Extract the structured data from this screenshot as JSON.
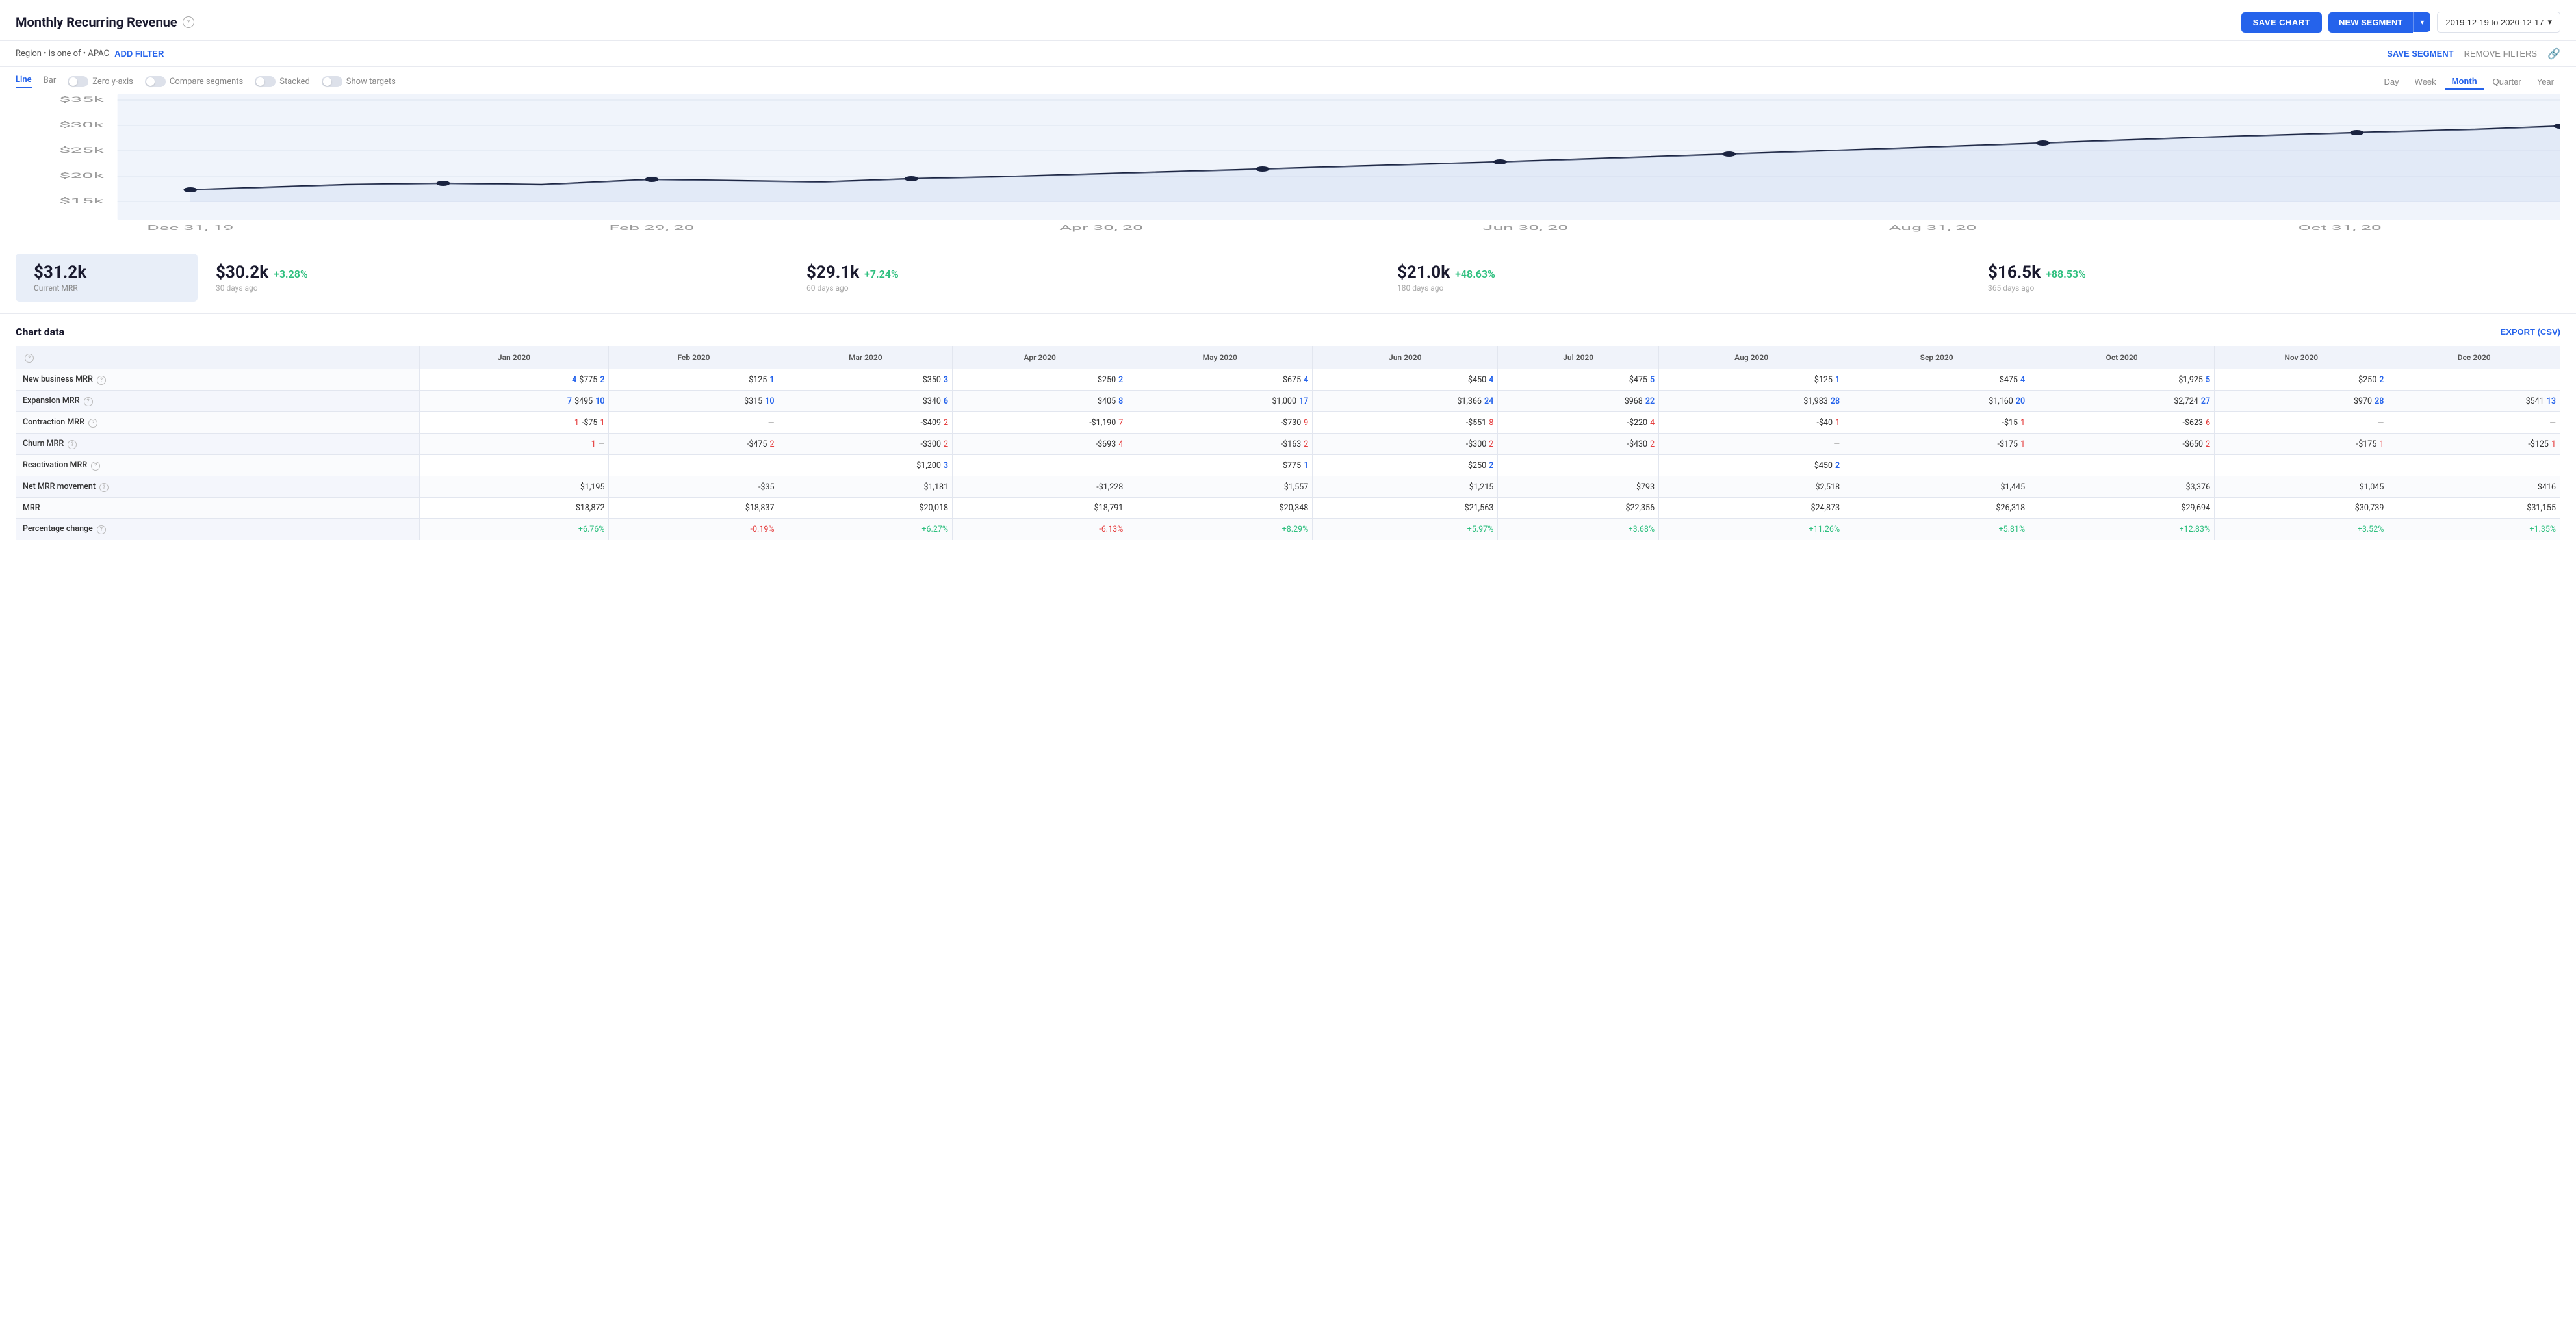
{
  "header": {
    "title": "Monthly Recurring Revenue",
    "save_chart_label": "SAVE CHART",
    "new_segment_label": "NEW SEGMENT",
    "date_range": "2019-12-19 to 2020-12-17"
  },
  "filter_bar": {
    "filter_text": "Region • is one of • APAC",
    "add_filter_label": "ADD FILTER",
    "save_segment_label": "SAVE SEGMENT",
    "remove_filters_label": "REMOVE FILTERS"
  },
  "chart_controls": {
    "tabs": [
      "Line",
      "Bar"
    ],
    "active_tab": "Line",
    "toggles": [
      {
        "label": "Zero y-axis",
        "enabled": false
      },
      {
        "label": "Compare segments",
        "enabled": false
      },
      {
        "label": "Stacked",
        "enabled": false
      },
      {
        "label": "Show targets",
        "enabled": false
      }
    ],
    "period_buttons": [
      "Day",
      "Week",
      "Month",
      "Quarter",
      "Year"
    ],
    "active_period": "Month"
  },
  "chart": {
    "y_labels": [
      "$35k",
      "$30k",
      "$25k",
      "$20k",
      "$15k"
    ],
    "x_labels": [
      "Dec 31, 19",
      "Feb 29, 20",
      "Apr 30, 20",
      "Jun 30, 20",
      "Aug 31, 20",
      "Oct 31, 20"
    ],
    "data_points": [
      {
        "x": 0.03,
        "y": 0.72
      },
      {
        "x": 0.1,
        "y": 0.64
      },
      {
        "x": 0.18,
        "y": 0.63
      },
      {
        "x": 0.27,
        "y": 0.64
      },
      {
        "x": 0.36,
        "y": 0.59
      },
      {
        "x": 0.43,
        "y": 0.61
      },
      {
        "x": 0.5,
        "y": 0.59
      },
      {
        "x": 0.52,
        "y": 0.57
      },
      {
        "x": 0.59,
        "y": 0.52
      },
      {
        "x": 0.66,
        "y": 0.49
      },
      {
        "x": 0.73,
        "y": 0.4
      },
      {
        "x": 0.82,
        "y": 0.33
      },
      {
        "x": 0.89,
        "y": 0.27
      },
      {
        "x": 0.93,
        "y": 0.22
      },
      {
        "x": 0.98,
        "y": 0.18
      },
      {
        "x": 1.0,
        "y": 0.16
      }
    ]
  },
  "stats": [
    {
      "value": "$31.2k",
      "label": "Current MRR",
      "change": null,
      "sub": null,
      "highlight": true
    },
    {
      "value": "$30.2k",
      "label": "30 days ago",
      "change": "+3.28%",
      "positive": true
    },
    {
      "value": "$29.1k",
      "label": "60 days ago",
      "change": "+7.24%",
      "positive": true
    },
    {
      "value": "$21.0k",
      "label": "180 days ago",
      "change": "+48.63%",
      "positive": true
    },
    {
      "value": "$16.5k",
      "label": "365 days ago",
      "change": "+88.53%",
      "positive": true
    }
  ],
  "chart_data": {
    "title": "Chart data",
    "export_label": "EXPORT (CSV)",
    "columns": [
      "",
      "Jan 2020",
      "Feb 2020",
      "Mar 2020",
      "Apr 2020",
      "May 2020",
      "Jun 2020",
      "Jul 2020",
      "Aug 2020",
      "Sep 2020",
      "Oct 2020",
      "Nov 2020",
      "Dec 2020"
    ],
    "rows": [
      {
        "label": "New business MRR",
        "has_help": true,
        "cells": [
          {
            "val": "$775",
            "count": "4",
            "count_color": "blue"
          },
          {
            "val": "$125",
            "count": "1",
            "count_color": "blue"
          },
          {
            "val": "$350",
            "count": "3",
            "count_color": "blue"
          },
          {
            "val": "$250",
            "count": "2",
            "count_color": "blue"
          },
          {
            "val": "$675",
            "count": "4",
            "count_color": "blue"
          },
          {
            "val": "$450",
            "count": "4",
            "count_color": "blue"
          },
          {
            "val": "$475",
            "count": "5",
            "count_color": "blue"
          },
          {
            "val": "$125",
            "count": "1",
            "count_color": "blue"
          },
          {
            "val": "$475",
            "count": "4",
            "count_color": "blue"
          },
          {
            "val": "$1,925",
            "count": "5",
            "count_color": "blue"
          },
          {
            "val": "$250",
            "count": "2",
            "count_color": "blue"
          },
          {
            "val": "",
            "count": "",
            "count_color": ""
          }
        ]
      },
      {
        "label": "Expansion MRR",
        "has_help": true,
        "cells": [
          {
            "val": "$495",
            "count": "7",
            "count_color": "blue"
          },
          {
            "val": "$315",
            "count": "10",
            "count_color": "blue"
          },
          {
            "val": "$340",
            "count": "6",
            "count_color": "blue"
          },
          {
            "val": "$405",
            "count": "8",
            "count_color": "blue"
          },
          {
            "val": "$1,000",
            "count": "17",
            "count_color": "blue"
          },
          {
            "val": "$1,366",
            "count": "24",
            "count_color": "blue"
          },
          {
            "val": "$968",
            "count": "22",
            "count_color": "blue"
          },
          {
            "val": "$1,983",
            "count": "28",
            "count_color": "blue"
          },
          {
            "val": "$1,160",
            "count": "20",
            "count_color": "blue"
          },
          {
            "val": "$2,724",
            "count": "27",
            "count_color": "blue"
          },
          {
            "val": "$970",
            "count": "28",
            "count_color": "blue"
          },
          {
            "val": "$541",
            "count": "13",
            "count_color": "blue"
          }
        ]
      },
      {
        "label": "Contraction MRR",
        "has_help": true,
        "cells": [
          {
            "val": "-$75",
            "count": "1",
            "count_color": "red"
          },
          {
            "val": "—",
            "count": "",
            "count_color": ""
          },
          {
            "val": "-$409",
            "count": "2",
            "count_color": "red"
          },
          {
            "val": "-$1,190",
            "count": "7",
            "count_color": "red"
          },
          {
            "val": "-$730",
            "count": "9",
            "count_color": "red"
          },
          {
            "val": "-$551",
            "count": "8",
            "count_color": "red"
          },
          {
            "val": "-$220",
            "count": "4",
            "count_color": "red"
          },
          {
            "val": "-$40",
            "count": "1",
            "count_color": "red"
          },
          {
            "val": "-$15",
            "count": "1",
            "count_color": "red"
          },
          {
            "val": "-$623",
            "count": "6",
            "count_color": "red"
          },
          {
            "val": "—",
            "count": "",
            "count_color": ""
          },
          {
            "val": "—",
            "count": "",
            "count_color": ""
          }
        ]
      },
      {
        "label": "Churn MRR",
        "has_help": true,
        "cells": [
          {
            "val": "—",
            "count": "1",
            "count_color": "red"
          },
          {
            "val": "-$475",
            "count": "2",
            "count_color": "red"
          },
          {
            "val": "-$300",
            "count": "2",
            "count_color": "red"
          },
          {
            "val": "-$693",
            "count": "4",
            "count_color": "red"
          },
          {
            "val": "-$163",
            "count": "2",
            "count_color": "red"
          },
          {
            "val": "-$300",
            "count": "2",
            "count_color": "red"
          },
          {
            "val": "-$430",
            "count": "2",
            "count_color": "red"
          },
          {
            "val": "—",
            "count": "",
            "count_color": ""
          },
          {
            "val": "-$175",
            "count": "1",
            "count_color": "red"
          },
          {
            "val": "-$650",
            "count": "2",
            "count_color": "red"
          },
          {
            "val": "-$175",
            "count": "1",
            "count_color": "red"
          },
          {
            "val": "-$125",
            "count": "1",
            "count_color": "red"
          }
        ]
      },
      {
        "label": "Reactivation MRR",
        "has_help": true,
        "cells": [
          {
            "val": "—",
            "count": "",
            "count_color": ""
          },
          {
            "val": "—",
            "count": "",
            "count_color": ""
          },
          {
            "val": "$1,200",
            "count": "3",
            "count_color": "blue"
          },
          {
            "val": "—",
            "count": "",
            "count_color": ""
          },
          {
            "val": "$775",
            "count": "1",
            "count_color": "blue"
          },
          {
            "val": "$250",
            "count": "2",
            "count_color": "blue"
          },
          {
            "val": "—",
            "count": "",
            "count_color": ""
          },
          {
            "val": "$450",
            "count": "2",
            "count_color": "blue"
          },
          {
            "val": "—",
            "count": "",
            "count_color": ""
          },
          {
            "val": "—",
            "count": "",
            "count_color": ""
          },
          {
            "val": "—",
            "count": "",
            "count_color": ""
          },
          {
            "val": "—",
            "count": "",
            "count_color": ""
          }
        ]
      },
      {
        "label": "Net MRR movement",
        "has_help": true,
        "cells": [
          {
            "val": "$1,195"
          },
          {
            "val": "-$35"
          },
          {
            "val": "$1,181"
          },
          {
            "val": "-$1,228"
          },
          {
            "val": "$1,557"
          },
          {
            "val": "$1,215"
          },
          {
            "val": "$793"
          },
          {
            "val": "$2,518"
          },
          {
            "val": "$1,445"
          },
          {
            "val": "$3,376"
          },
          {
            "val": "$1,045"
          },
          {
            "val": "$416"
          }
        ]
      },
      {
        "label": "MRR",
        "has_help": false,
        "cells": [
          {
            "val": "$18,872"
          },
          {
            "val": "$18,837"
          },
          {
            "val": "$20,018"
          },
          {
            "val": "$18,791"
          },
          {
            "val": "$20,348"
          },
          {
            "val": "$21,563"
          },
          {
            "val": "$22,356"
          },
          {
            "val": "$24,873"
          },
          {
            "val": "$26,318"
          },
          {
            "val": "$29,694"
          },
          {
            "val": "$30,739"
          },
          {
            "val": "$31,155"
          }
        ]
      },
      {
        "label": "Percentage change",
        "has_help": true,
        "is_pct": true,
        "cells": [
          {
            "val": "+6.76%",
            "positive": true
          },
          {
            "val": "-0.19%",
            "positive": false
          },
          {
            "val": "+6.27%",
            "positive": true
          },
          {
            "val": "-6.13%",
            "positive": false
          },
          {
            "val": "+8.29%",
            "positive": true
          },
          {
            "val": "+5.97%",
            "positive": true
          },
          {
            "val": "+3.68%",
            "positive": true
          },
          {
            "val": "+11.26%",
            "positive": true
          },
          {
            "val": "+5.81%",
            "positive": true
          },
          {
            "val": "+12.83%",
            "positive": true
          },
          {
            "val": "+3.52%",
            "positive": true
          },
          {
            "val": "+1.35%",
            "positive": true
          }
        ]
      }
    ]
  }
}
